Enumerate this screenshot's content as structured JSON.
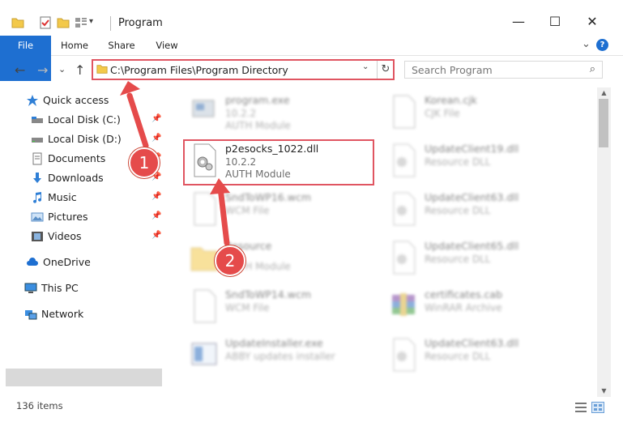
{
  "window": {
    "title": "Program",
    "minimize": "—",
    "maximize": "☐",
    "close": "✕"
  },
  "ribbon": {
    "tabs": [
      "File",
      "Home",
      "Share",
      "View"
    ],
    "expand": "⌄",
    "help": "?"
  },
  "nav": {
    "back": "←",
    "forward": "→",
    "recent": "⌄",
    "up": "↑"
  },
  "address": {
    "path": "C:\\Program Files\\Program Directory",
    "dropdown": "⌄",
    "refresh": "↻"
  },
  "search": {
    "placeholder": "Search Program",
    "icon": "⌕"
  },
  "sidebar": {
    "items": [
      {
        "label": "Quick access",
        "icon": "star-icon"
      },
      {
        "label": "Local Disk (C:)",
        "icon": "drive-icon",
        "pinned": true
      },
      {
        "label": "Local Disk (D:)",
        "icon": "drive-icon",
        "pinned": true
      },
      {
        "label": "Documents",
        "icon": "documents-icon",
        "pinned": true
      },
      {
        "label": "Downloads",
        "icon": "downloads-icon",
        "pinned": true
      },
      {
        "label": "Music",
        "icon": "music-icon",
        "pinned": true
      },
      {
        "label": "Pictures",
        "icon": "pictures-icon",
        "pinned": true
      },
      {
        "label": "Videos",
        "icon": "videos-icon",
        "pinned": true
      },
      {
        "label": "OneDrive",
        "icon": "cloud-icon"
      },
      {
        "label": "This PC",
        "icon": "computer-icon",
        "selected": true
      },
      {
        "label": "Network",
        "icon": "network-icon"
      }
    ],
    "pin_glyph": "📌"
  },
  "files": [
    {
      "name": "program.exe",
      "version": "10.2.2",
      "type": "AUTH Module",
      "icon": "exe-icon",
      "blurred": true
    },
    {
      "name": "Korean.cjk",
      "version": "",
      "type": "CJK File",
      "icon": "file-icon",
      "blurred": true
    },
    {
      "name": "p2esocks_1022.dll",
      "version": "10.2.2",
      "type": "AUTH Module",
      "icon": "dll-gear-icon",
      "blurred": false,
      "highlighted": true
    },
    {
      "name": "UpdateClient19.dll",
      "version": "",
      "type": "Resource DLL",
      "icon": "dll-gear-icon",
      "blurred": true
    },
    {
      "name": "SndToWP16.wcm",
      "version": "",
      "type": "WCM File",
      "icon": "file-icon",
      "blurred": true
    },
    {
      "name": "UpdateClient63.dll",
      "version": "",
      "type": "Resource DLL",
      "icon": "dll-gear-icon",
      "blurred": true
    },
    {
      "name": "Resource",
      "version": "",
      "type": "AUTH Module",
      "icon": "folder-icon",
      "blurred": true
    },
    {
      "name": "UpdateClient65.dll",
      "version": "",
      "type": "Resource DLL",
      "icon": "dll-gear-icon",
      "blurred": true
    },
    {
      "name": "SndToWP14.wcm",
      "version": "",
      "type": "WCM File",
      "icon": "file-icon",
      "blurred": true
    },
    {
      "name": "certificates.cab",
      "version": "",
      "type": "WinRAR Archive",
      "icon": "archive-icon",
      "blurred": true
    },
    {
      "name": "UpdateInstaller.exe",
      "version": "",
      "type": "ABBY updates installer",
      "icon": "installer-icon",
      "blurred": true
    },
    {
      "name": "UpdateClient63.dll",
      "version": "",
      "type": "Resource DLL",
      "icon": "dll-gear-icon",
      "blurred": true
    }
  ],
  "status": {
    "count": "136 items"
  },
  "callouts": [
    "1",
    "2"
  ],
  "colors": {
    "accent": "#1e6fd1",
    "highlight": "#e05561",
    "arrow": "#e54b4b"
  }
}
